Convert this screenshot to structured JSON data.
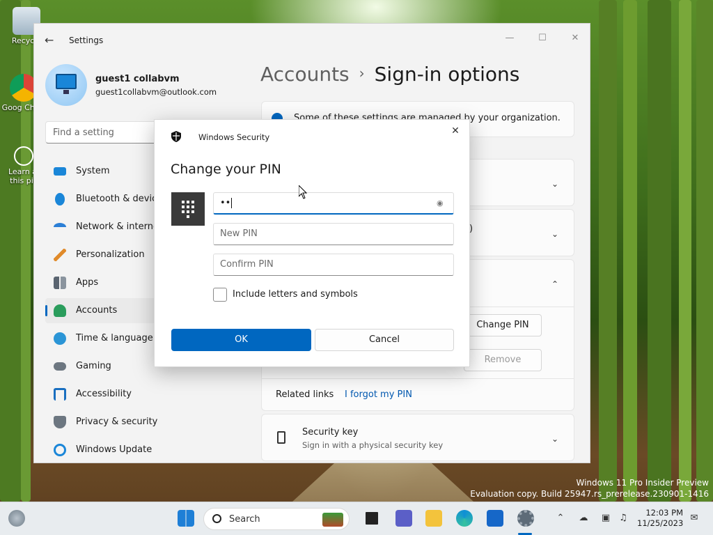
{
  "desktop": {
    "icons": [
      {
        "label": "Recycle",
        "icon": "recycle-bin-icon"
      },
      {
        "label": "Goog Chror",
        "icon": "chrome-icon"
      },
      {
        "label": "Learn al this pic",
        "icon": "learn-about-picture-icon"
      }
    ],
    "watermark_line1": "Windows 11 Pro Insider Preview",
    "watermark_line2": "Evaluation copy. Build 25947.rs_prerelease.230901-1416"
  },
  "settings": {
    "app_title": "Settings",
    "profile": {
      "name": "guest1 collabvm",
      "email": "guest1collabvm@outlook.com"
    },
    "search_placeholder": "Find a setting",
    "nav": [
      {
        "label": "System",
        "icon": "system-icon",
        "color": "#1a86d8"
      },
      {
        "label": "Bluetooth & devic",
        "icon": "bluetooth-icon",
        "color": "#1a86d8"
      },
      {
        "label": "Network & interne",
        "icon": "network-icon",
        "color": "#2b7fd6"
      },
      {
        "label": "Personalization",
        "icon": "brush-icon",
        "color": "#e08a2a"
      },
      {
        "label": "Apps",
        "icon": "apps-icon",
        "color": "#5a6470"
      },
      {
        "label": "Accounts",
        "icon": "accounts-icon",
        "color": "#2a9d5c",
        "active": true
      },
      {
        "label": "Time & language",
        "icon": "globe-clock-icon",
        "color": "#2b95d6"
      },
      {
        "label": "Gaming",
        "icon": "gamepad-icon",
        "color": "#6c7680"
      },
      {
        "label": "Accessibility",
        "icon": "accessibility-icon",
        "color": "#1a6fc0"
      },
      {
        "label": "Privacy & security",
        "icon": "shield-icon",
        "color": "#6c7680"
      },
      {
        "label": "Windows Update",
        "icon": "update-icon",
        "color": "#1a86d8"
      }
    ],
    "breadcrumb": {
      "parent": "Accounts",
      "separator": "›",
      "current": "Sign-in options"
    },
    "org_notice": "Some of these settings are managed by your organization.",
    "partial_text": ")",
    "change_pin_button": "Change PIN",
    "remove_button": "Remove",
    "related_links_label": "Related links",
    "forgot_pin_link": "I forgot my PIN",
    "security_key": {
      "title": "Security key",
      "subtitle": "Sign in with a physical security key"
    }
  },
  "dialog": {
    "app_name": "Windows Security",
    "heading": "Change your PIN",
    "current_pin_value": "••",
    "new_pin_placeholder": "New PIN",
    "confirm_pin_placeholder": "Confirm PIN",
    "checkbox_label": "Include letters and symbols",
    "checkbox_checked": false,
    "ok_label": "OK",
    "cancel_label": "Cancel"
  },
  "taskbar": {
    "search_label": "Search",
    "time": "12:03 PM",
    "date": "11/25/2023",
    "accent": "#0067c0"
  }
}
